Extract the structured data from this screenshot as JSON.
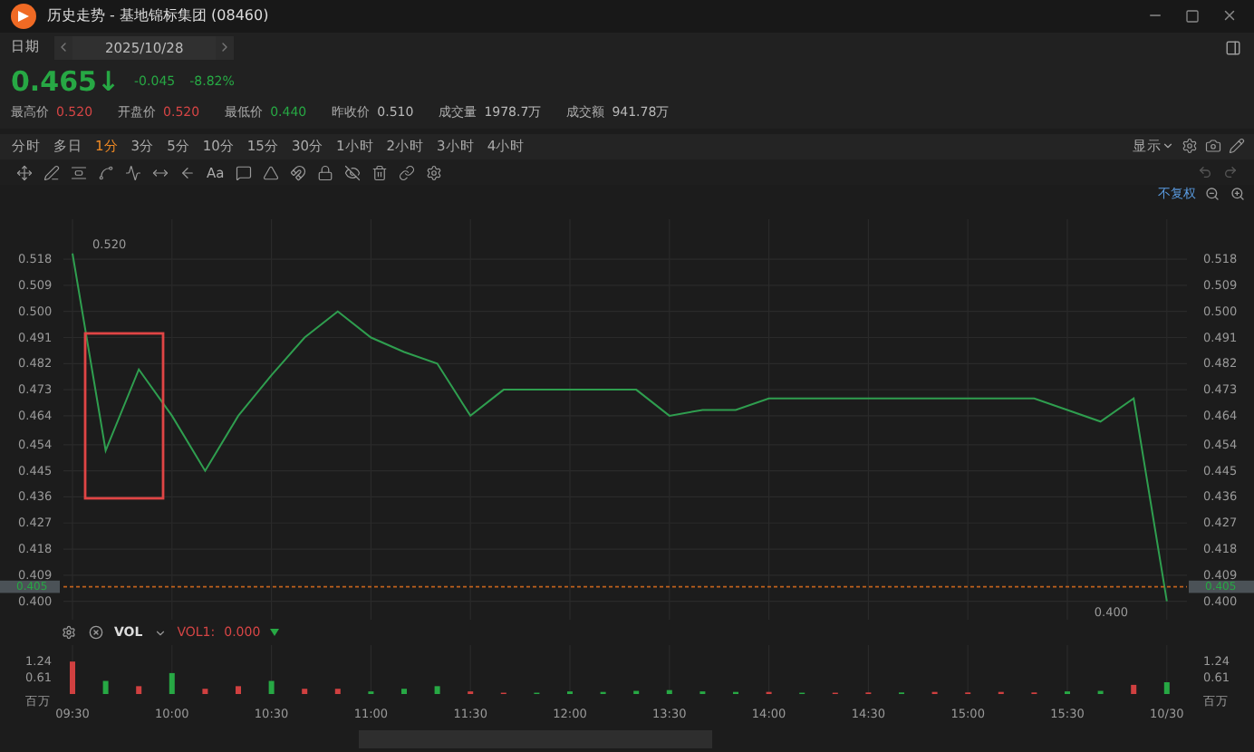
{
  "window": {
    "title": "历史走势 - 基地锦标集团 (08460)"
  },
  "date": {
    "label": "日期",
    "value": "2025/10/28"
  },
  "quote": {
    "price": "0.465",
    "arrow": "↓",
    "change": "-0.045",
    "change_pct": "-8.82%",
    "color": "#27a844"
  },
  "stats": [
    {
      "label": "最高价",
      "value": "0.520",
      "color": "#d64545"
    },
    {
      "label": "开盘价",
      "value": "0.520",
      "color": "#d64545"
    },
    {
      "label": "最低价",
      "value": "0.440",
      "color": "#27a844"
    },
    {
      "label": "昨收价",
      "value": "0.510",
      "color": "#b8b8b8"
    },
    {
      "label": "成交量",
      "value": "1978.7万",
      "color": "#b8b8b8"
    },
    {
      "label": "成交额",
      "value": "941.78万",
      "color": "#b8b8b8"
    }
  ],
  "periods": [
    {
      "label": "分时",
      "selected": false
    },
    {
      "label": "多日",
      "selected": false
    },
    {
      "label": "1分",
      "selected": true
    },
    {
      "label": "3分",
      "selected": false
    },
    {
      "label": "5分",
      "selected": false
    },
    {
      "label": "10分",
      "selected": false
    },
    {
      "label": "15分",
      "selected": false
    },
    {
      "label": "30分",
      "selected": false
    },
    {
      "label": "1小时",
      "selected": false
    },
    {
      "label": "2小时",
      "selected": false
    },
    {
      "label": "3小时",
      "selected": false
    },
    {
      "label": "4小时",
      "selected": false
    }
  ],
  "display_menu": {
    "label": "显示"
  },
  "tools": [
    {
      "kind": "move"
    },
    {
      "kind": "line"
    },
    {
      "kind": "channel"
    },
    {
      "kind": "wave"
    },
    {
      "kind": "fib"
    },
    {
      "kind": "measure"
    },
    {
      "kind": "arrow"
    },
    {
      "kind": "text",
      "label": "Aa"
    },
    {
      "kind": "comment"
    },
    {
      "kind": "angle"
    },
    {
      "kind": "magnet"
    },
    {
      "kind": "lock"
    },
    {
      "kind": "hide"
    },
    {
      "kind": "delete"
    },
    {
      "kind": "link"
    },
    {
      "kind": "settings"
    }
  ],
  "adjust_mode": {
    "label": "不复权"
  },
  "price_chart": {
    "drawings": [
      {
        "kind": "rectangle"
      }
    ],
    "right_axis": [
      "0.518",
      "0.509",
      "0.500",
      "0.491",
      "0.482",
      "0.473",
      "0.464",
      "0.454",
      "0.445",
      "0.436",
      "0.427",
      "0.418",
      "0.409",
      "0.400"
    ],
    "last_price_tags": [
      "0.405",
      "0.405"
    ],
    "chart_data": {
      "type": "line",
      "grid": true,
      "categories": [
        null,
        null,
        null,
        null,
        null,
        null,
        null,
        null,
        null,
        null,
        null,
        null,
        null,
        null,
        null,
        null,
        null,
        null,
        null,
        null,
        null,
        null,
        null,
        null,
        null,
        null,
        null,
        null,
        null,
        null,
        null,
        null,
        null,
        null
      ],
      "ylim": [
        0.3905,
        0.5318
      ],
      "series": [
        {
          "color": "#2f9e4f",
          "values": [
            0.52,
            0.452,
            0.48,
            0.464,
            0.445,
            0.464,
            0.478,
            0.491,
            0.5,
            0.491,
            0.486,
            0.482,
            0.464,
            0.473,
            0.473,
            0.473,
            0.473,
            0.473,
            0.464,
            0.466,
            0.466,
            0.47,
            0.47,
            0.47,
            0.47,
            0.47,
            0.47,
            0.47,
            0.47,
            0.47,
            0.466,
            0.462,
            0.47,
            0.4
          ]
        }
      ],
      "yticks": [
        {
          "value": 0.4,
          "label": "0.400"
        },
        {
          "value": 0.409,
          "label": "0.409"
        },
        {
          "value": 0.418,
          "label": "0.418"
        },
        {
          "value": 0.427,
          "label": "0.427"
        },
        {
          "value": 0.436,
          "label": "0.436"
        },
        {
          "value": 0.445,
          "label": "0.445"
        },
        {
          "value": 0.454,
          "label": "0.454"
        },
        {
          "value": 0.464,
          "label": "0.464"
        },
        {
          "value": 0.473,
          "label": "0.473"
        },
        {
          "value": 0.482,
          "label": "0.482"
        },
        {
          "value": 0.491,
          "label": "0.491"
        },
        {
          "value": 0.5,
          "label": "0.500"
        },
        {
          "value": 0.509,
          "label": "0.509"
        },
        {
          "value": 0.518,
          "label": "0.518"
        }
      ],
      "ref_lines": [
        {
          "axis": "y",
          "value": 0.405,
          "color": "#c0611c"
        }
      ],
      "annotations": [
        "0.520",
        "0.400"
      ]
    }
  },
  "volume_panel": {
    "indicator": "VOL",
    "reading_label": "VOL1:",
    "reading": "0.000",
    "unit": "百万",
    "unit_right": "百万",
    "right_axis": [
      "1.24",
      "0.61"
    ]
  },
  "volume_chart": {
    "chart_data": {
      "type": "bar",
      "grid": true,
      "categories": [
        "09:30",
        null,
        null,
        "10:00",
        null,
        null,
        "10:30",
        null,
        null,
        "11:00",
        null,
        null,
        "11:30",
        null,
        null,
        "12:00",
        null,
        null,
        "13:30",
        null,
        null,
        "14:00",
        null,
        null,
        "14:30",
        null,
        null,
        "15:00",
        null,
        null,
        "15:30",
        null,
        null,
        "10/30"
      ],
      "stacked": true,
      "ylim": [
        0,
        1.87
      ],
      "series": [
        {
          "color": "#d04040",
          "values": [
            1.24,
            null,
            0.3,
            null,
            0.2,
            0.3,
            null,
            0.2,
            0.2,
            null,
            null,
            null,
            0.1,
            0.05,
            null,
            null,
            null,
            null,
            null,
            null,
            null,
            0.08,
            null,
            0.05,
            0.06,
            null,
            0.08,
            0.06,
            0.08,
            0.06,
            null,
            null,
            0.35,
            null
          ]
        },
        {
          "color": "#27a844",
          "values": [
            null,
            0.5,
            null,
            0.8,
            null,
            null,
            0.5,
            null,
            null,
            0.1,
            0.2,
            0.3,
            null,
            null,
            0.05,
            0.1,
            0.08,
            0.12,
            0.15,
            0.1,
            0.08,
            null,
            0.05,
            null,
            null,
            0.06,
            null,
            null,
            null,
            null,
            0.1,
            0.12,
            null,
            0.45
          ]
        }
      ],
      "yticks": [
        {
          "value": 0.61,
          "label": "0.61"
        },
        {
          "value": 1.24,
          "label": "1.24"
        }
      ]
    }
  }
}
